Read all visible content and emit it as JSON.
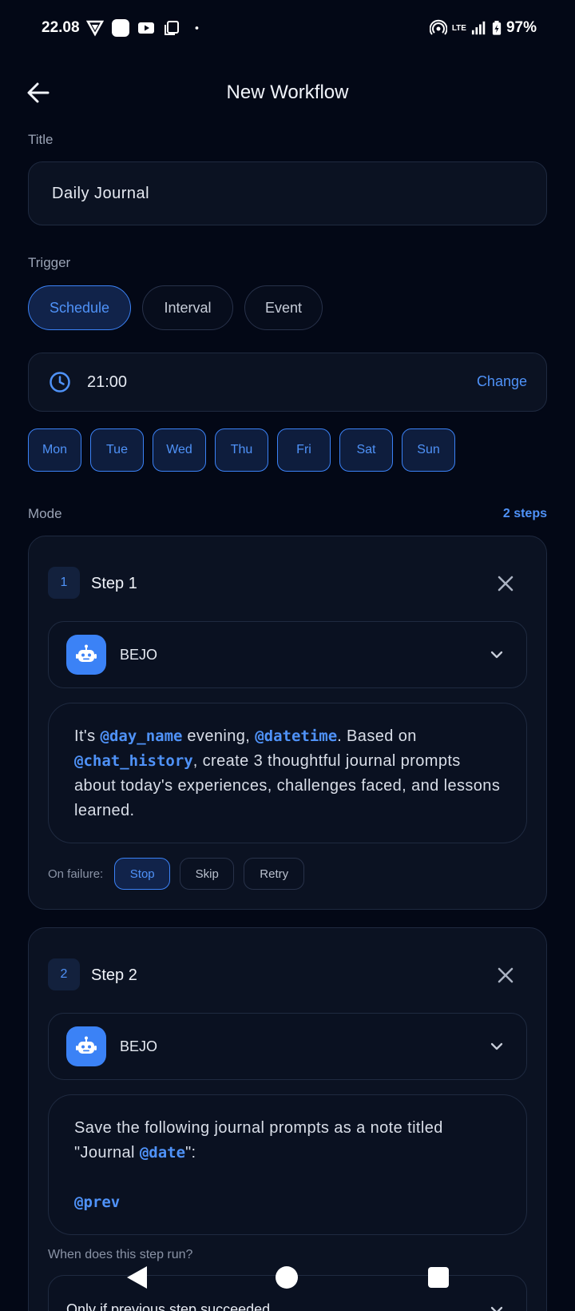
{
  "status_bar": {
    "time": "22.08",
    "battery": "97%",
    "network": "LTE",
    "icons": [
      "vpn-icon",
      "app-icon",
      "youtube-icon",
      "copy-icon",
      "dot-icon",
      "hotspot-icon",
      "signal-icon",
      "battery-icon"
    ]
  },
  "header": {
    "title": "New Workflow",
    "back_icon": "arrow-left-icon"
  },
  "title_section": {
    "label": "Title",
    "value": "Daily Journal"
  },
  "trigger": {
    "label": "Trigger",
    "options": [
      {
        "label": "Schedule",
        "active": true
      },
      {
        "label": "Interval",
        "active": false
      },
      {
        "label": "Event",
        "active": false
      }
    ],
    "time": "21:00",
    "change_label": "Change",
    "days": [
      {
        "label": "Mon",
        "selected": true
      },
      {
        "label": "Tue",
        "selected": true
      },
      {
        "label": "Wed",
        "selected": true
      },
      {
        "label": "Thu",
        "selected": true
      },
      {
        "label": "Fri",
        "selected": true
      },
      {
        "label": "Sat",
        "selected": true
      },
      {
        "label": "Sun",
        "selected": true
      }
    ]
  },
  "mode": {
    "label": "Mode",
    "steps_count": "2 steps"
  },
  "steps": [
    {
      "number": "1",
      "title": "Step 1",
      "agent": "BEJO",
      "prompt": {
        "t1": "It's ",
        "v1": "@day_name",
        "t2": " evening, ",
        "v2": "@datetime",
        "t3": ". Based on ",
        "v3": "@chat_history",
        "t4": ", create 3 thoughtful journal prompts about today's experiences, challenges faced, and lessons learned."
      },
      "on_failure": {
        "label": "On failure:",
        "options": [
          {
            "label": "Stop",
            "active": true
          },
          {
            "label": "Skip",
            "active": false
          },
          {
            "label": "Retry",
            "active": false
          }
        ]
      }
    },
    {
      "number": "2",
      "title": "Step 2",
      "agent": "BEJO",
      "prompt": {
        "t1": "Save the following journal prompts as a note titled \"Journal ",
        "v1": "@date",
        "t2": "\":",
        "v2": "@prev"
      },
      "when_label": "When does this step run?",
      "when_value": "Only if previous step succeeded"
    }
  ],
  "nav_bar": {
    "icons": [
      "nav-back-icon",
      "nav-home-icon",
      "nav-recents-icon"
    ]
  }
}
